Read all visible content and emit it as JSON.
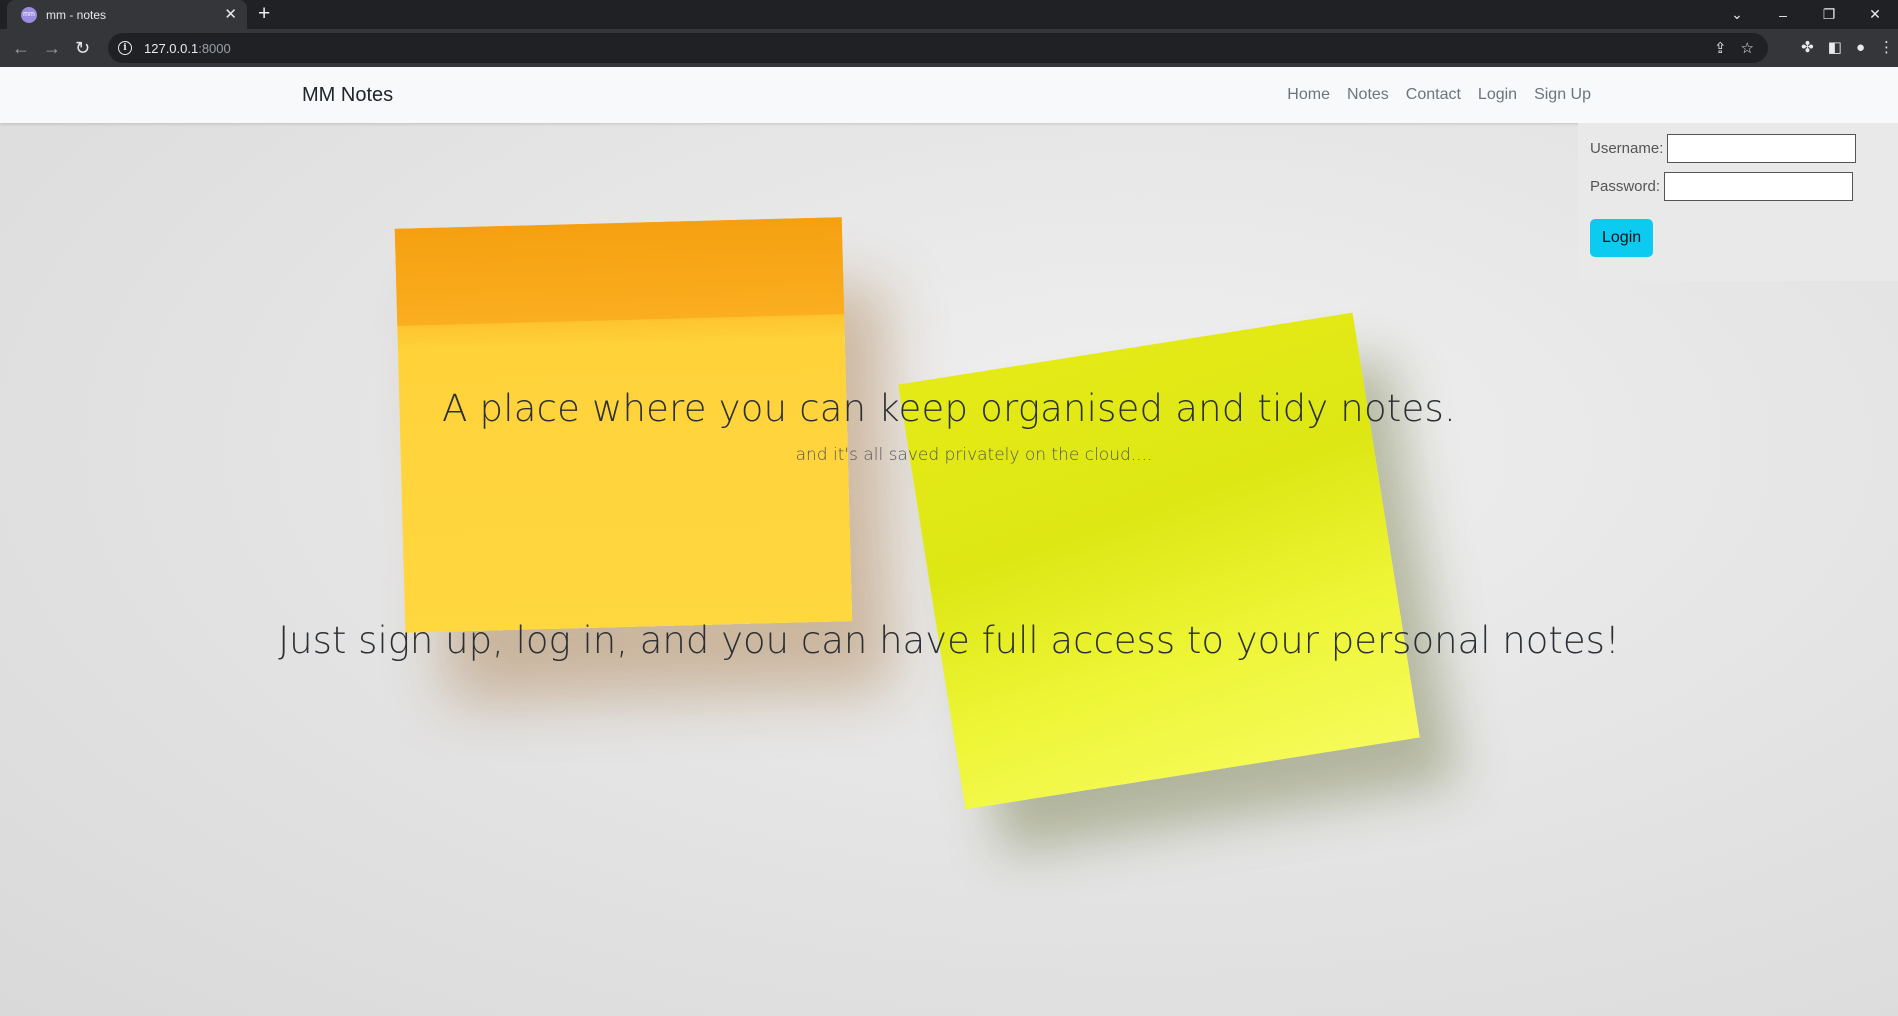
{
  "browser": {
    "tab_title": "mm - notes",
    "favicon_text": "mm",
    "url_host": "127.0.0.1",
    "url_port": ":8000"
  },
  "navbar": {
    "brand": "MM Notes",
    "links": [
      "Home",
      "Notes",
      "Contact",
      "Login",
      "Sign Up"
    ]
  },
  "hero": {
    "headline": "A place where you can keep organised and tidy notes.",
    "subline": "and it's all saved privately on the cloud....",
    "cta": "Just sign up, log in, and you can have full access to your personal notes!"
  },
  "login": {
    "username_label": "Username:",
    "password_label": "Password:",
    "username_value": "",
    "password_value": "",
    "button_label": "Login",
    "button_color": "#0dcaf0"
  }
}
